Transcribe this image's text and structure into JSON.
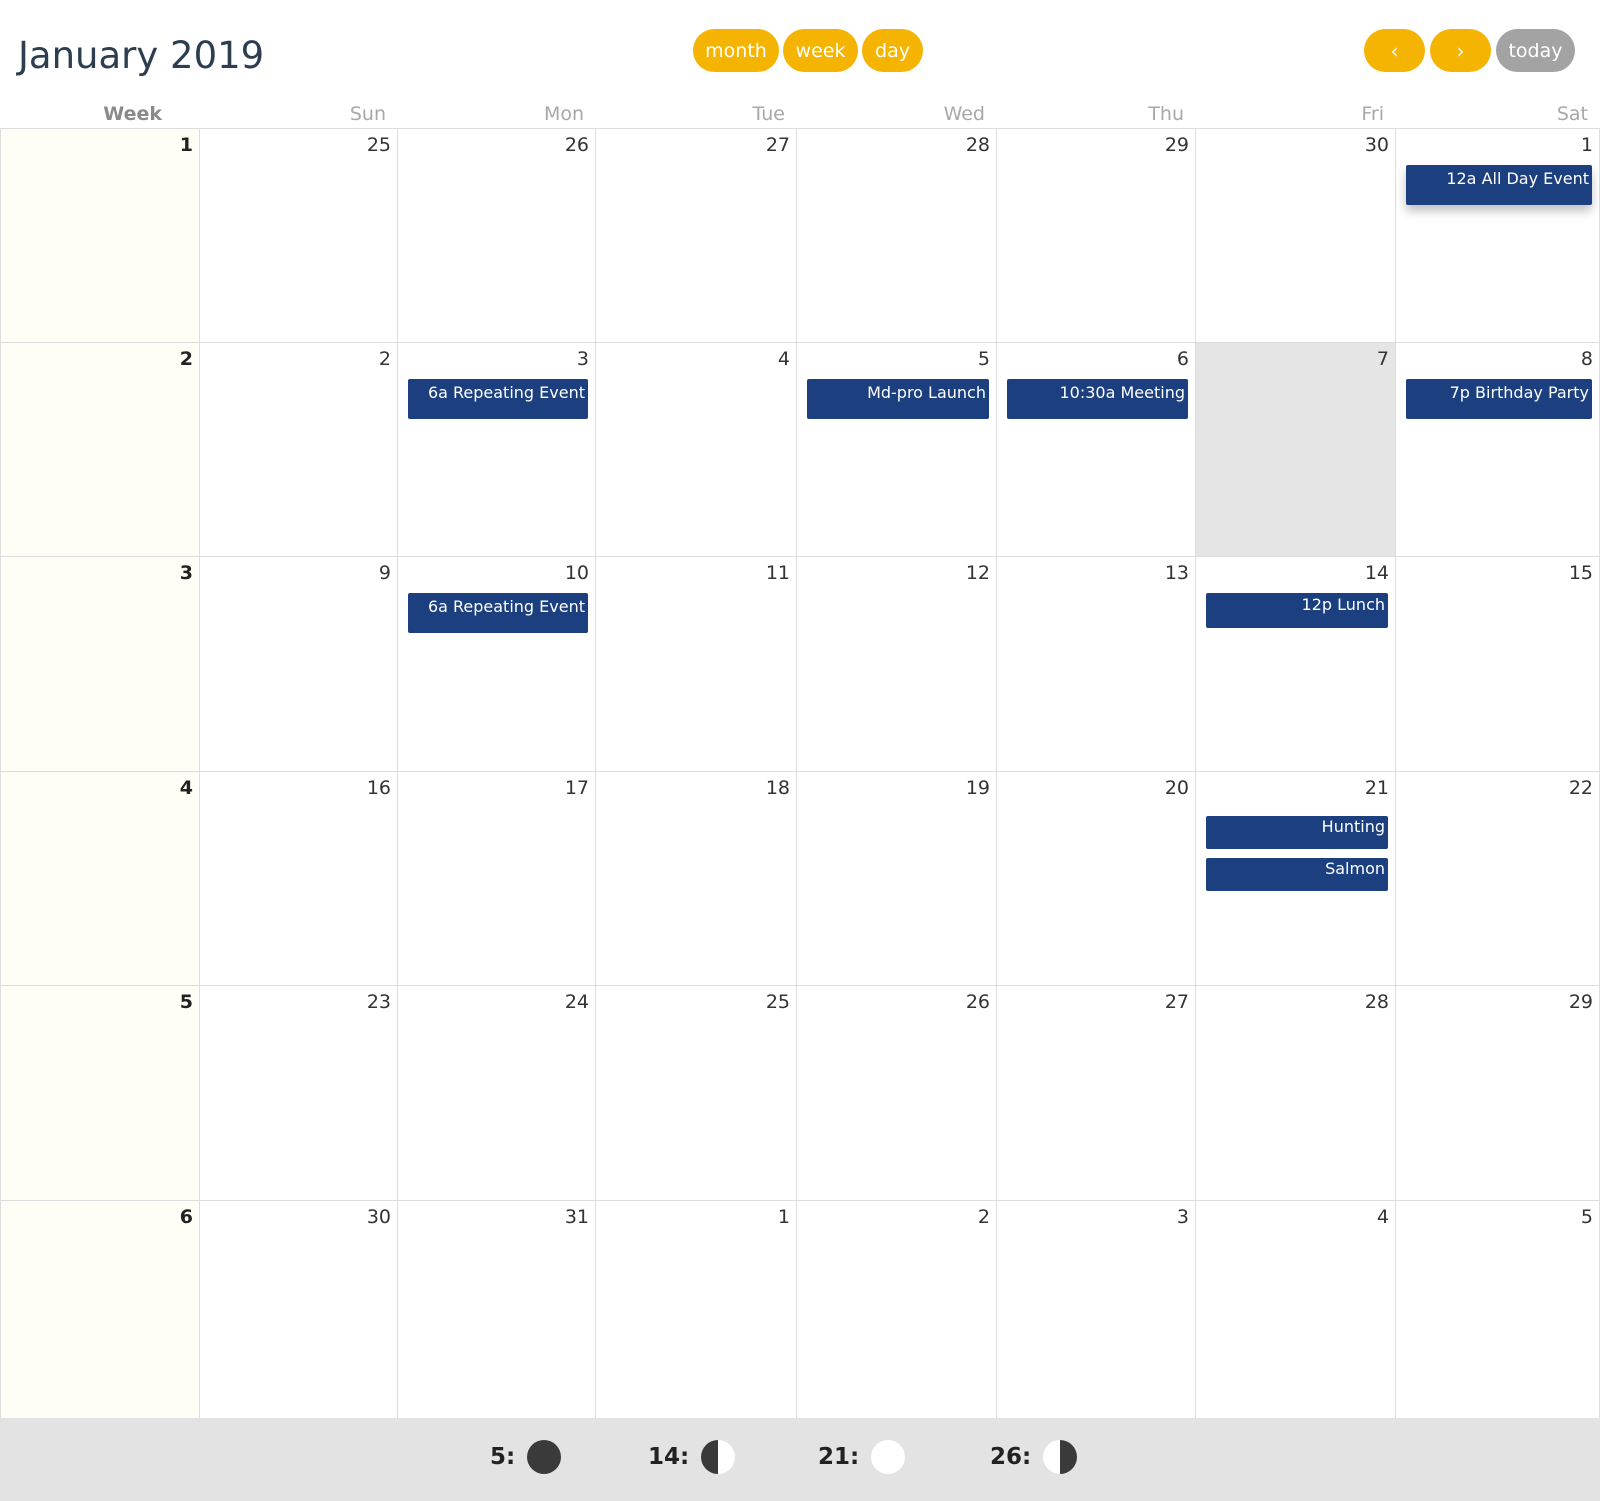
{
  "header": {
    "title": "January 2019",
    "views": [
      "month",
      "week",
      "day"
    ],
    "prev_label": "‹",
    "next_label": "›",
    "today_label": "today"
  },
  "columns": {
    "week_label": "Week",
    "days": [
      "Sun",
      "Mon",
      "Tue",
      "Wed",
      "Thu",
      "Fri",
      "Sat"
    ]
  },
  "weeks": [
    {
      "week": "1",
      "days": [
        "25",
        "26",
        "27",
        "28",
        "29",
        "30",
        "1"
      ]
    },
    {
      "week": "2",
      "days": [
        "2",
        "3",
        "4",
        "5",
        "6",
        "7",
        "8"
      ]
    },
    {
      "week": "3",
      "days": [
        "9",
        "10",
        "11",
        "12",
        "13",
        "14",
        "15"
      ]
    },
    {
      "week": "4",
      "days": [
        "16",
        "17",
        "18",
        "19",
        "20",
        "21",
        "22"
      ]
    },
    {
      "week": "5",
      "days": [
        "23",
        "24",
        "25",
        "26",
        "27",
        "28",
        "29"
      ]
    },
    {
      "week": "6",
      "days": [
        "30",
        "31",
        "1",
        "2",
        "3",
        "4",
        "5"
      ]
    }
  ],
  "today": {
    "week_index": 1,
    "day_index": 5
  },
  "events": [
    {
      "title": "12a All Day Event",
      "week_index": 0,
      "day_index": 6,
      "slot": 0,
      "all_day": true
    },
    {
      "title": "6a Repeating Event",
      "week_index": 1,
      "day_index": 1,
      "slot": 0
    },
    {
      "title": "Md-pro Launch",
      "week_index": 1,
      "day_index": 3,
      "slot": 0
    },
    {
      "title": "10:30a Meeting",
      "week_index": 1,
      "day_index": 4,
      "slot": 0
    },
    {
      "title": "7p Birthday Party",
      "week_index": 1,
      "day_index": 6,
      "slot": 0
    },
    {
      "title": "6a Repeating Event",
      "week_index": 2,
      "day_index": 1,
      "slot": 0
    },
    {
      "title": "12p Lunch",
      "week_index": 2,
      "day_index": 5,
      "slot": 0
    },
    {
      "title": "Hunting",
      "week_index": 3,
      "day_index": 5,
      "slot": 0
    },
    {
      "title": "Salmon",
      "week_index": 3,
      "day_index": 5,
      "slot": 1
    }
  ],
  "moon_phases": [
    {
      "label": "5:",
      "phase": "new"
    },
    {
      "label": "14:",
      "phase": "first"
    },
    {
      "label": "21:",
      "phase": "full"
    },
    {
      "label": "26:",
      "phase": "last"
    }
  ],
  "colors": {
    "accent": "#f5b302",
    "today_button": "#a3a3a3",
    "event": "#1c3f80",
    "today_cell": "#e5e5e5",
    "week_column": "#fffdf5",
    "footer": "#e3e3e3"
  }
}
